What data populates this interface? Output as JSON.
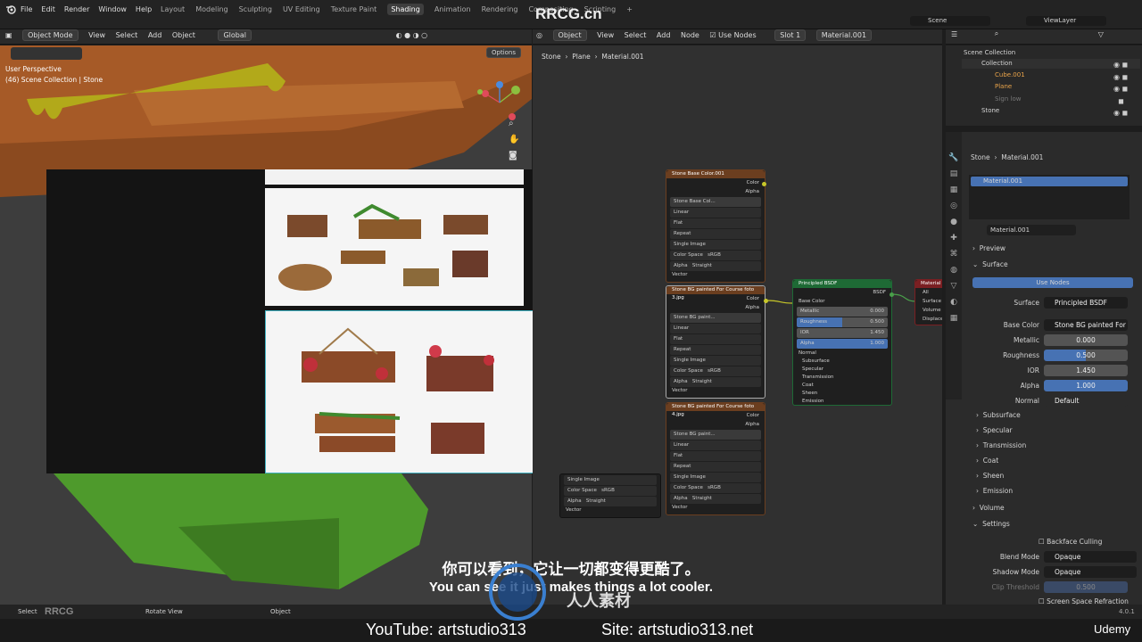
{
  "app": {
    "menu": [
      "File",
      "Edit",
      "Render",
      "Window",
      "Help"
    ],
    "workspaces": [
      "Layout",
      "Modeling",
      "Sculpting",
      "UV Editing",
      "Texture Paint",
      "Shading",
      "Animation",
      "Rendering",
      "Compositing",
      "Scripting"
    ],
    "active_workspace": "Shading",
    "scene": "Scene",
    "view_layer": "ViewLayer",
    "watermark_top": "RRCG.cn"
  },
  "viewport": {
    "mode": "Object Mode",
    "menus": [
      "View",
      "Select",
      "Add",
      "Object"
    ],
    "orientation": "Global",
    "options": "Options",
    "perspective": "User Perspective",
    "collection_info": "(46) Scene Collection | Stone"
  },
  "node_editor": {
    "object_dropdown": "Object",
    "menus": [
      "View",
      "Select",
      "Add",
      "Node"
    ],
    "use_nodes": "Use Nodes",
    "slot": "Slot 1",
    "material": "Material.001",
    "breadcrumb": [
      "Stone",
      "Plane",
      "Material.001"
    ],
    "tex_nodes": [
      {
        "title": "Stone Base Color.001",
        "image": "Stone Base Col...",
        "outputs": [
          "Color",
          "Alpha"
        ],
        "rows": [
          "Linear",
          "Flat",
          "Repeat",
          "Single Image"
        ],
        "colorspace": "sRGB",
        "alpha": "Straight",
        "vector": "Vector"
      },
      {
        "title": "Stone BG painted For Course foto 3.jpg",
        "image": "Stone BG paint...",
        "outputs": [
          "Color",
          "Alpha"
        ],
        "rows": [
          "Linear",
          "Flat",
          "Repeat",
          "Single Image"
        ],
        "colorspace": "sRGB",
        "alpha": "Straight",
        "vector": "Vector"
      },
      {
        "title": "Stone BG painted For Course foto 4.jpg",
        "image": "Stone BG paint...",
        "outputs": [
          "Color",
          "Alpha"
        ],
        "rows": [
          "Linear",
          "Flat",
          "Repeat",
          "Single Image"
        ],
        "colorspace": "sRGB",
        "alpha": "Straight",
        "vector": "Vector"
      }
    ],
    "left_node": {
      "rows": [
        "Single Image"
      ],
      "colorspace": "sRGB",
      "alpha": "Straight",
      "vector": "Vector"
    },
    "labels": {
      "color_space": "Color Space",
      "alpha": "Alpha"
    },
    "bsdf": {
      "title": "Principled BSDF",
      "output": "BSDF",
      "base_color": "Base Color",
      "metallic_label": "Metallic",
      "metallic": "0.000",
      "roughness_label": "Roughness",
      "roughness": "0.500",
      "ior_label": "IOR",
      "ior": "1.450",
      "alpha_label": "Alpha",
      "alpha": "1.000",
      "normal": "Normal",
      "sections": [
        "Subsurface",
        "Specular",
        "Transmission",
        "Coat",
        "Sheen",
        "Emission"
      ]
    },
    "output_node": {
      "title": "Material",
      "rows": [
        "All",
        "Surface",
        "Volume",
        "Displacem"
      ]
    }
  },
  "outliner": {
    "root": "Scene Collection",
    "items": [
      "Collection",
      "Cube.001",
      "Plane",
      "Sign low",
      "Stone"
    ]
  },
  "properties": {
    "breadcrumb": [
      "Stone",
      "Material.001"
    ],
    "slot": "Material.001",
    "material": "Material.001",
    "panels": {
      "preview": "Preview",
      "surface": "Surface",
      "volume": "Volume",
      "settings": "Settings"
    },
    "use_nodes": "Use Nodes",
    "surface_label": "Surface",
    "surface": "Principled BSDF",
    "base_color_label": "Base Color",
    "base_color": "Stone BG painted For ...",
    "metallic_label": "Metallic",
    "metallic": "0.000",
    "roughness_label": "Roughness",
    "roughness": "0.500",
    "ior_label": "IOR",
    "ior": "1.450",
    "alpha_label": "Alpha",
    "alpha": "1.000",
    "normal_label": "Normal",
    "normal": "Default",
    "subpanels": [
      "Subsurface",
      "Specular",
      "Transmission",
      "Coat",
      "Sheen",
      "Emission"
    ],
    "backface": "Backface Culling",
    "blend_label": "Blend Mode",
    "blend": "Opaque",
    "shadow_label": "Shadow Mode",
    "shadow": "Opaque",
    "clip_label": "Clip Threshold",
    "clip": "0.500",
    "ssr": "Screen Space Refraction"
  },
  "status": {
    "select": "Select",
    "rotate": "Rotate View",
    "object": "Object",
    "version": "4.0.1"
  },
  "overlay": {
    "subtitle_cn": "你可以看到，它让一切都变得更酷了。",
    "subtitle_en": "You can see it just makes things a lot cooler.",
    "youtube": "YouTube: artstudio313",
    "site": "Site: artstudio313.net",
    "brand": "Udemy",
    "logo_text": "RRCG",
    "logo_sub": "人人素材"
  },
  "colors": {
    "accent": "#4772b3",
    "tex_header": "#6b3e1f",
    "bsdf_header": "#1e6a35",
    "output_header": "#7a1f22",
    "socket_yellow": "#c7c729",
    "socket_grey": "#a1a1a1",
    "socket_blue": "#6363c7",
    "wood": "#8b4a1f"
  }
}
